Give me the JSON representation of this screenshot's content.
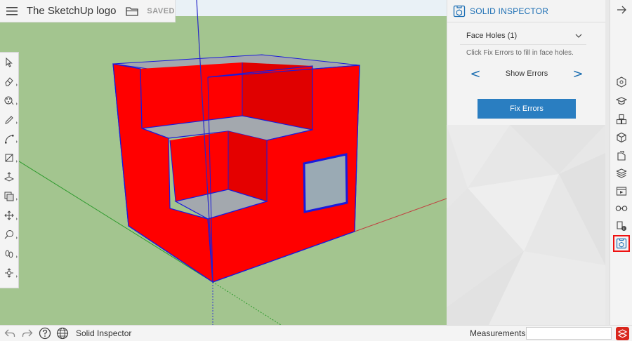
{
  "app": {
    "title": "The SketchUp logo",
    "save_status": "SAVED"
  },
  "colors": {
    "accent": "#1d6fb4",
    "button": "#2a7ec1",
    "ground": "#a3c58f",
    "solid_face": "#ff0000",
    "hole_fill": "#9aaab4",
    "active_outline": "#e11111"
  },
  "toolbar": {
    "tools": [
      {
        "name": "select-icon"
      },
      {
        "name": "eraser-icon"
      },
      {
        "name": "paint-bucket-icon"
      },
      {
        "name": "pencil-icon"
      },
      {
        "name": "arc-icon"
      },
      {
        "name": "rectangle-icon"
      },
      {
        "name": "push-pull-icon"
      },
      {
        "name": "offset-icon"
      },
      {
        "name": "move-icon"
      },
      {
        "name": "tape-measure-icon"
      },
      {
        "name": "walk-icon"
      },
      {
        "name": "orbit-icon"
      }
    ]
  },
  "inspector": {
    "title": "SOLID INSPECTOR",
    "issue_select": "Face Holes (1)",
    "hint": "Click Fix Errors to fill in face holes.",
    "prev_arrow": "<",
    "next_arrow": ">",
    "nav_label": "Show Errors",
    "fix_button": "Fix Errors"
  },
  "tray": {
    "icons": [
      "entity-info-icon",
      "instructor-icon",
      "components-icon",
      "materials-icon",
      "styles-icon",
      "layers-icon",
      "scenes-icon",
      "display-icon",
      "model-info-icon",
      "solid-inspector-icon"
    ],
    "active": "solid-inspector-icon"
  },
  "status": {
    "text": "Solid Inspector",
    "measurements_label": "Measurements",
    "measurements_value": ""
  }
}
